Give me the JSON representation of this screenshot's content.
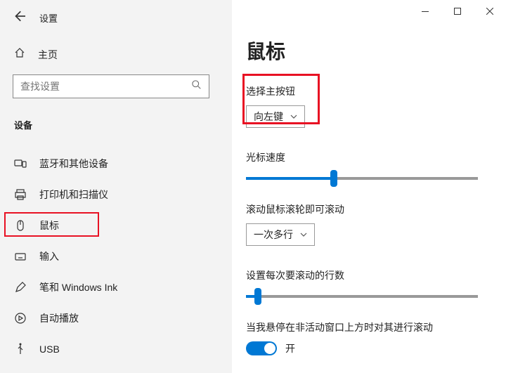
{
  "titlebar": {
    "app_name": "设置"
  },
  "sidebar": {
    "home_label": "主页",
    "search_placeholder": "查找设置",
    "section_label": "设备",
    "items": [
      {
        "label": "蓝牙和其他设备"
      },
      {
        "label": "打印机和扫描仪"
      },
      {
        "label": "鼠标"
      },
      {
        "label": "输入"
      },
      {
        "label": "笔和 Windows Ink"
      },
      {
        "label": "自动播放"
      },
      {
        "label": "USB"
      }
    ]
  },
  "main": {
    "page_title": "鼠标",
    "primary_button": {
      "label": "选择主按钮",
      "selected": "向左键"
    },
    "cursor_speed": {
      "label": "光标速度",
      "value_percent": 38
    },
    "scroll_mode": {
      "label": "滚动鼠标滚轮即可滚动",
      "selected": "一次多行"
    },
    "scroll_lines": {
      "label": "设置每次要滚动的行数",
      "value_percent": 5
    },
    "hover_scroll": {
      "label": "当我悬停在非活动窗口上方时对其进行滚动",
      "state_label": "开"
    }
  }
}
